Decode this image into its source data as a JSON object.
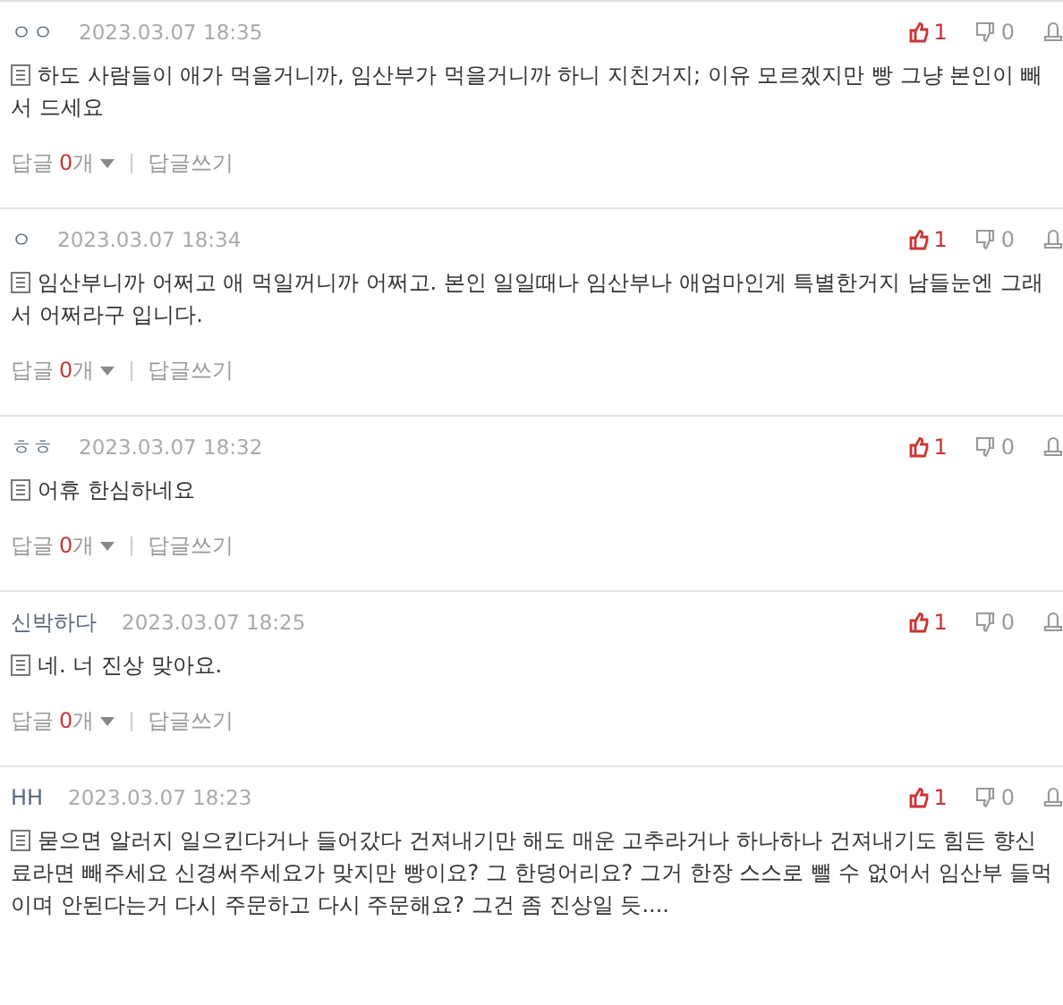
{
  "comments": [
    {
      "author": "ㅇㅇ",
      "date": "2023.03.07 18:35",
      "likes": "1",
      "dislikes": "0",
      "text": "하도 사람들이 애가 먹을거니까, 임산부가 먹을거니까 하니 지친거지; 이유 모르겠지만 빵 그냥 본인이 빼서 드세요",
      "replies": {
        "label": "답글",
        "count": "0",
        "unit": "개",
        "write": "답글쓰기"
      }
    },
    {
      "author": "ㅇ",
      "date": "2023.03.07 18:34",
      "likes": "1",
      "dislikes": "0",
      "text": "임산부니까 어쩌고 애 먹일꺼니까 어쩌고. 본인 일일때나 임산부나 애엄마인게 특별한거지 남들눈엔 그래서 어쩌라구 입니다.",
      "replies": {
        "label": "답글",
        "count": "0",
        "unit": "개",
        "write": "답글쓰기"
      }
    },
    {
      "author": "ㅎㅎ",
      "date": "2023.03.07 18:32",
      "likes": "1",
      "dislikes": "0",
      "text": "어휴 한심하네요",
      "replies": {
        "label": "답글",
        "count": "0",
        "unit": "개",
        "write": "답글쓰기"
      }
    },
    {
      "author": "신박하다",
      "date": "2023.03.07 18:25",
      "likes": "1",
      "dislikes": "0",
      "text": "네. 너 진상 맞아요.",
      "replies": {
        "label": "답글",
        "count": "0",
        "unit": "개",
        "write": "답글쓰기"
      }
    },
    {
      "author": "HH",
      "date": "2023.03.07 18:23",
      "likes": "1",
      "dislikes": "0",
      "text": "묻으면 알러지 일으킨다거나 들어갔다 건져내기만 해도 매운 고추라거나 하나하나 건져내기도 힘든 향신료라면 빼주세요 신경써주세요가 맞지만 빵이요? 그 한덩어리요? 그거 한장 스스로 뺄 수 없어서 임산부 들먹이며 안된다는거 다시 주문하고 다시 주문해요? 그건 좀 진상일 듯...."
    }
  ]
}
